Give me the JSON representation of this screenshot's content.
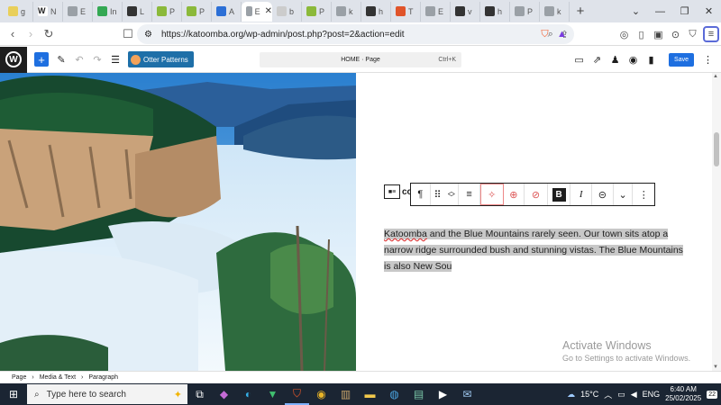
{
  "browser": {
    "tabs": [
      {
        "label": "g",
        "color": "#e9cf5a"
      },
      {
        "label": "N",
        "color": "#ffffff",
        "glyph": "W"
      },
      {
        "label": "E",
        "color": "#9aa0a6"
      },
      {
        "label": "In",
        "color": "#34a853"
      },
      {
        "label": "L",
        "color": "#333333"
      },
      {
        "label": "P",
        "color": "#8bb93a"
      },
      {
        "label": "P",
        "color": "#8bb93a"
      },
      {
        "label": "A",
        "color": "#2c6fd6"
      },
      {
        "label": "E",
        "color": "#9aa0a6",
        "active": true
      },
      {
        "label": "b",
        "color": "#cccccc"
      },
      {
        "label": "P",
        "color": "#8bb93a"
      },
      {
        "label": "k",
        "color": "#9aa0a6"
      },
      {
        "label": "h",
        "color": "#333333"
      },
      {
        "label": "T",
        "color": "#e0542a"
      },
      {
        "label": "E",
        "color": "#9aa0a6"
      },
      {
        "label": "v",
        "color": "#333333"
      },
      {
        "label": "h",
        "color": "#333333"
      },
      {
        "label": "P",
        "color": "#9aa0a6"
      },
      {
        "label": "k",
        "color": "#9aa0a6"
      }
    ],
    "new_tab": "+",
    "window_controls": {
      "dropdown": "⌄",
      "minimize": "—",
      "restore": "❐",
      "close": "✕"
    },
    "url": "https://katoomba.org/wp-admin/post.php?post=2&action=edit",
    "tab_close": "✕"
  },
  "wp_header": {
    "logo": "W",
    "add": "+",
    "otter_label": "Otter Patterns",
    "command_title": "HOME · Page",
    "command_shortcut": "Ctrl+K",
    "save_label": "Save"
  },
  "editor": {
    "heading_fragment": "co",
    "paragraph": {
      "misspelled": "Katoomba",
      "text_after": " and the Blue Mountains rarely seen.  Our town sits atop a narrow ridge surrounded bush and stunning vistas.  The Blue Mountains is also New Sou"
    },
    "toolbar": {
      "paragraph": "¶",
      "drag": "⠿",
      "align": "≡",
      "bold": "B",
      "italic": "I",
      "link": "⊝",
      "more": "⌄",
      "options": "⋮"
    }
  },
  "breadcrumbs": [
    "Page",
    "Media & Text",
    "Paragraph"
  ],
  "watermark": {
    "title": "Activate Windows",
    "subtitle": "Go to Settings to activate Windows."
  },
  "taskbar": {
    "search_placeholder": "Type here to search",
    "weather": "15°C",
    "language": "ENG",
    "time": "6:40 AM",
    "date": "25/02/2025",
    "notifications": "22"
  }
}
